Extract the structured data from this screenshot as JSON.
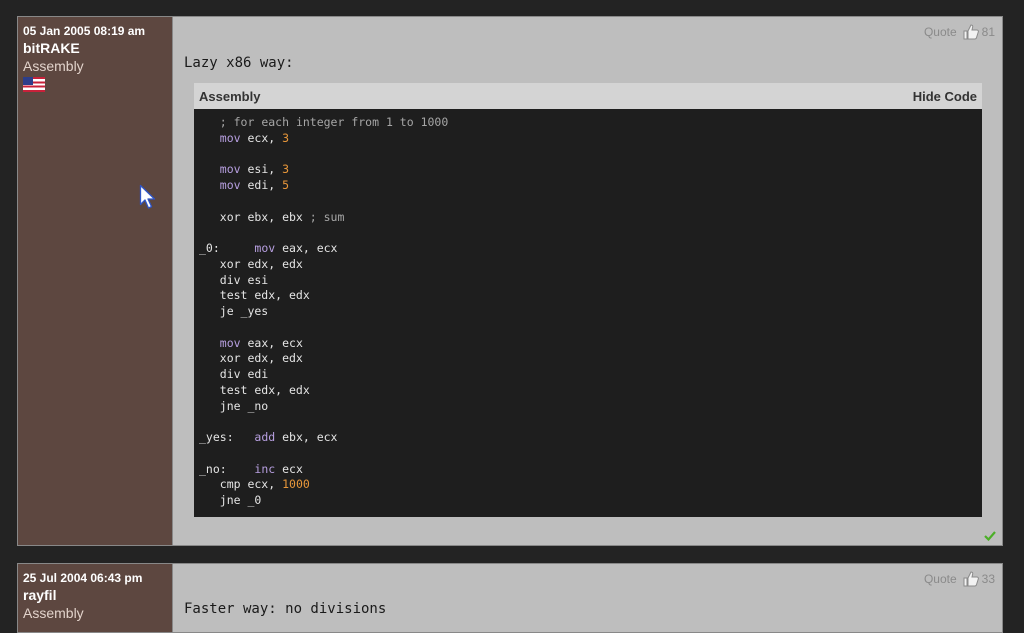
{
  "posts": [
    {
      "date": "05 Jan 2005 08:19 am",
      "author": "bitRAKE",
      "forum": "Assembly",
      "quote_label": "Quote",
      "likes": "81",
      "message": "Lazy x86 way:",
      "code": {
        "language": "Assembly",
        "toggle_label": "Hide Code",
        "lines": [
          [
            {
              "t": "   "
            },
            {
              "t": "; for each integer from 1 to 1000",
              "c": "cm"
            }
          ],
          [
            {
              "t": "   "
            },
            {
              "t": "mov",
              "c": "kw"
            },
            {
              "t": " ecx, "
            },
            {
              "t": "3",
              "c": "num"
            }
          ],
          [],
          [
            {
              "t": "   "
            },
            {
              "t": "mov",
              "c": "kw"
            },
            {
              "t": " esi, "
            },
            {
              "t": "3",
              "c": "num"
            }
          ],
          [
            {
              "t": "   "
            },
            {
              "t": "mov",
              "c": "kw"
            },
            {
              "t": " edi, "
            },
            {
              "t": "5",
              "c": "num"
            }
          ],
          [],
          [
            {
              "t": "   xor ebx, ebx "
            },
            {
              "t": "; sum",
              "c": "cm"
            }
          ],
          [],
          [
            {
              "t": "_0:     "
            },
            {
              "t": "mov",
              "c": "kw"
            },
            {
              "t": " eax, ecx"
            }
          ],
          [
            {
              "t": "   xor edx, edx"
            }
          ],
          [
            {
              "t": "   div esi"
            }
          ],
          [
            {
              "t": "   test edx, edx"
            }
          ],
          [
            {
              "t": "   je _yes"
            }
          ],
          [],
          [
            {
              "t": "   "
            },
            {
              "t": "mov",
              "c": "kw"
            },
            {
              "t": " eax, ecx"
            }
          ],
          [
            {
              "t": "   xor edx, edx"
            }
          ],
          [
            {
              "t": "   div edi"
            }
          ],
          [
            {
              "t": "   test edx, edx"
            }
          ],
          [
            {
              "t": "   jne _no"
            }
          ],
          [],
          [
            {
              "t": "_yes:   "
            },
            {
              "t": "add",
              "c": "kw"
            },
            {
              "t": " ebx, ecx"
            }
          ],
          [],
          [
            {
              "t": "_no:    "
            },
            {
              "t": "inc",
              "c": "kw"
            },
            {
              "t": " ecx"
            }
          ],
          [
            {
              "t": "   cmp ecx, "
            },
            {
              "t": "1000",
              "c": "num"
            }
          ],
          [
            {
              "t": "   jne _0"
            }
          ]
        ]
      }
    },
    {
      "date": "25 Jul 2004 06:43 pm",
      "author": "rayfil",
      "forum": "Assembly",
      "quote_label": "Quote",
      "likes": "33",
      "message": "Faster way: no divisions"
    }
  ],
  "icons": {
    "thumb": "thumbs-up-icon",
    "flag": "us-flag-icon",
    "check": "check-icon",
    "cursor": "mouse-cursor"
  },
  "colors": {
    "sidebar": "#5d4740",
    "content": "#bebebe",
    "code_bg": "#1e1e1e",
    "keyword": "#b79fe0",
    "number": "#e8973a",
    "comment": "#a6a6a6"
  }
}
